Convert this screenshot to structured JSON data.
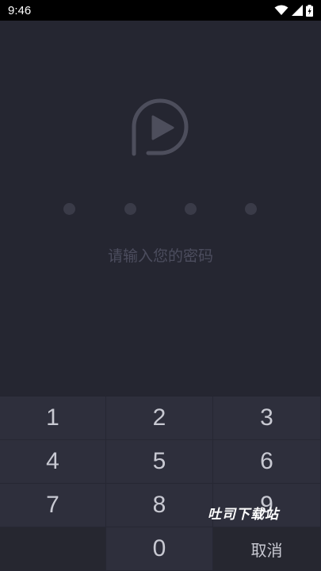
{
  "status_bar": {
    "time": "9:46",
    "icons": [
      "wifi-icon",
      "signal-icon",
      "battery-charging-icon"
    ]
  },
  "lock_screen": {
    "logo_icon": "play-logo-icon",
    "pin_length": 4,
    "prompt": "请输入您的密码"
  },
  "keypad": {
    "keys": [
      "1",
      "2",
      "3",
      "4",
      "5",
      "6",
      "7",
      "8",
      "9",
      "",
      "0",
      "取消"
    ]
  },
  "watermark": "吐司下载站"
}
